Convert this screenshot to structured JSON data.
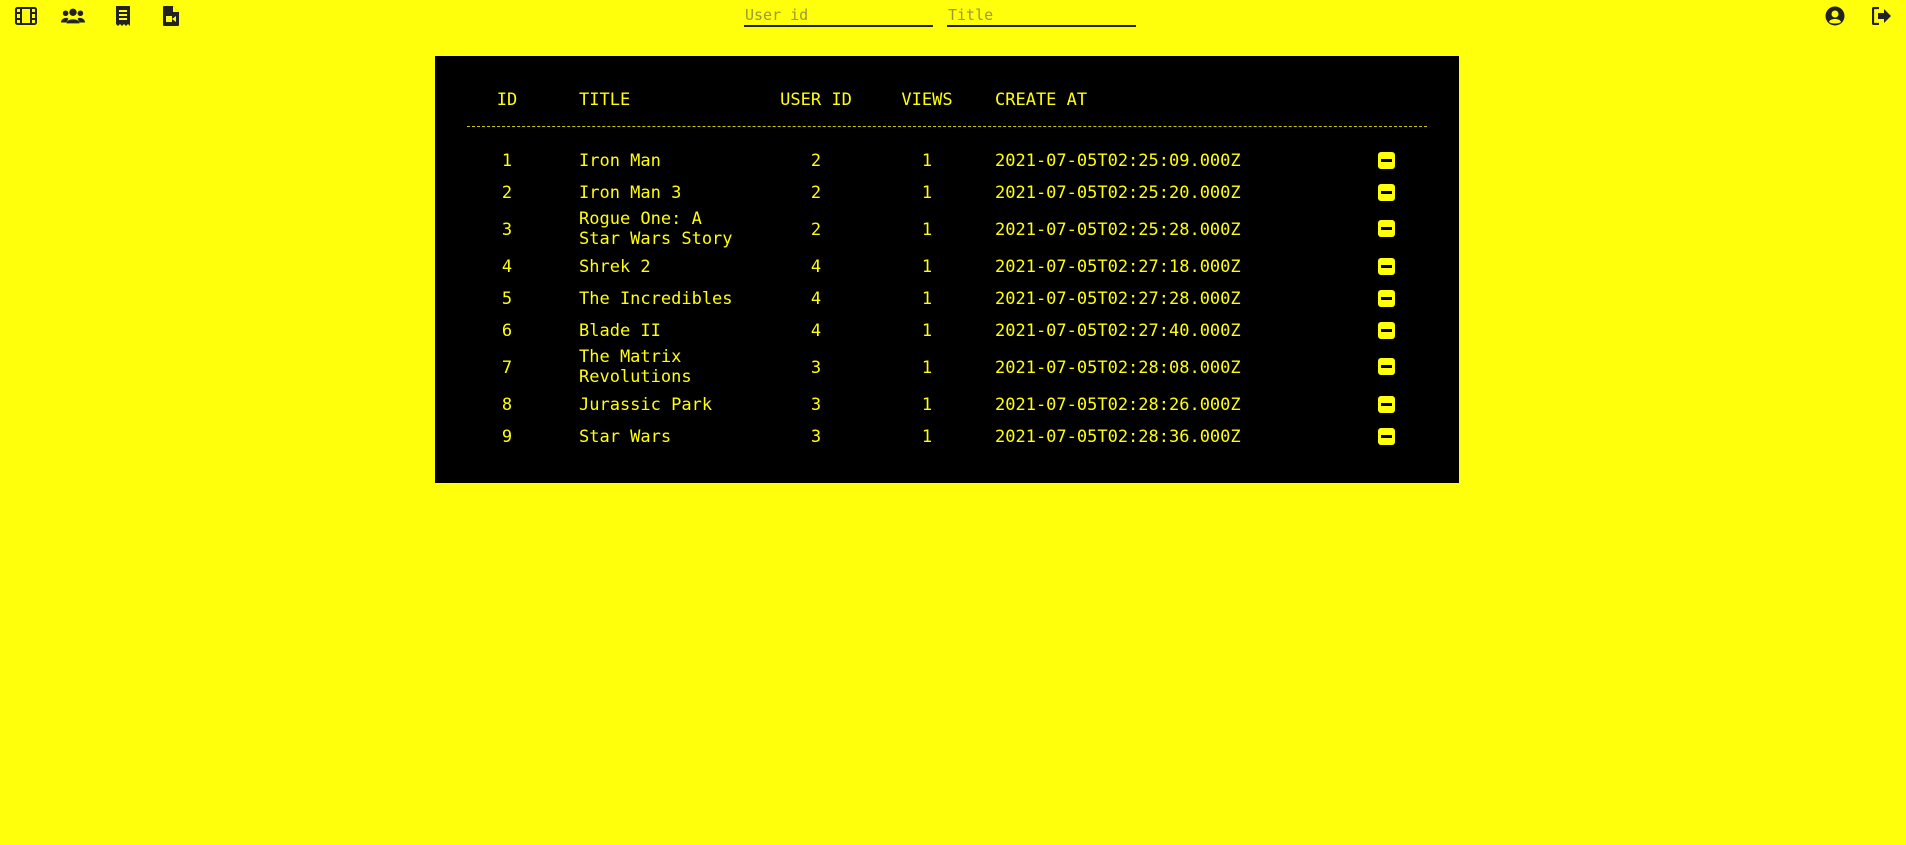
{
  "nav": {
    "icons": [
      "film-icon",
      "users-icon",
      "receipt-icon",
      "file-video-icon"
    ]
  },
  "search": {
    "user_id_placeholder": "User id",
    "title_placeholder": "Title"
  },
  "header_right": {
    "icons": [
      "user-circle-icon",
      "sign-out-icon"
    ]
  },
  "table": {
    "columns": [
      "ID",
      "TITLE",
      "USER ID",
      "VIEWS",
      "CREATE AT"
    ],
    "rows": [
      {
        "id": "1",
        "title": "Iron Man",
        "user_id": "2",
        "views": "1",
        "created_at": "2021-07-05T02:25:09.000Z"
      },
      {
        "id": "2",
        "title": "Iron Man 3",
        "user_id": "2",
        "views": "1",
        "created_at": "2021-07-05T02:25:20.000Z"
      },
      {
        "id": "3",
        "title": "Rogue One: A Star Wars Story",
        "user_id": "2",
        "views": "1",
        "created_at": "2021-07-05T02:25:28.000Z"
      },
      {
        "id": "4",
        "title": "Shrek 2",
        "user_id": "4",
        "views": "1",
        "created_at": "2021-07-05T02:27:18.000Z"
      },
      {
        "id": "5",
        "title": "The Incredibles",
        "user_id": "4",
        "views": "1",
        "created_at": "2021-07-05T02:27:28.000Z"
      },
      {
        "id": "6",
        "title": "Blade II",
        "user_id": "4",
        "views": "1",
        "created_at": "2021-07-05T02:27:40.000Z"
      },
      {
        "id": "7",
        "title": "The Matrix Revolutions",
        "user_id": "3",
        "views": "1",
        "created_at": "2021-07-05T02:28:08.000Z"
      },
      {
        "id": "8",
        "title": "Jurassic Park",
        "user_id": "3",
        "views": "1",
        "created_at": "2021-07-05T02:28:26.000Z"
      },
      {
        "id": "9",
        "title": "Star Wars",
        "user_id": "3",
        "views": "1",
        "created_at": "2021-07-05T02:28:36.000Z"
      }
    ],
    "row_action_icon": "minus-square-icon"
  },
  "colors": {
    "background": "#ffff0b",
    "panel": "#000000",
    "text": "#ffff0b"
  }
}
